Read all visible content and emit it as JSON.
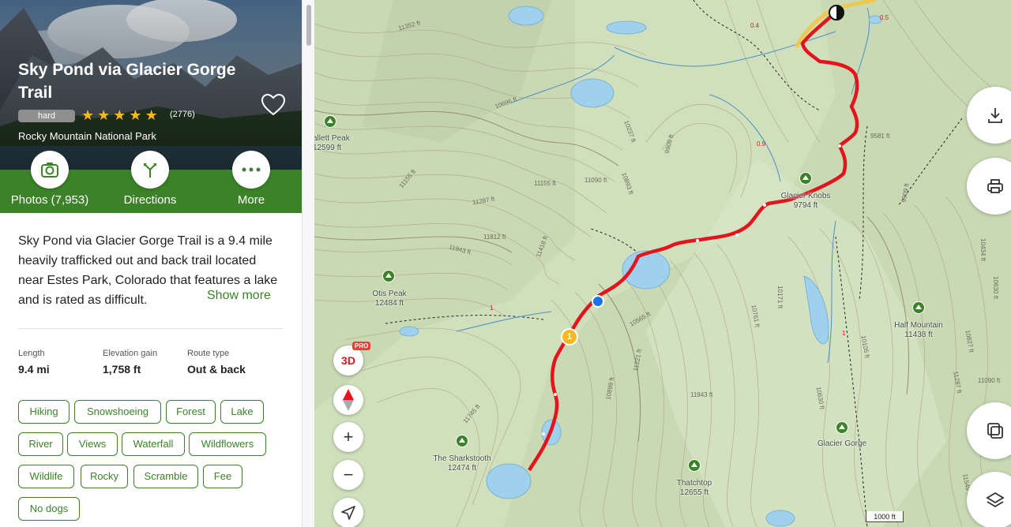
{
  "trail": {
    "title": "Sky Pond via Glacier Gorge Trail",
    "difficulty": "hard",
    "rating": 5,
    "review_count": "(2776)",
    "park": "Rocky Mountain National Park"
  },
  "actions": {
    "photos": "Photos (7,953)",
    "directions": "Directions",
    "more": "More"
  },
  "description": {
    "text": "Sky Pond via Glacier Gorge Trail is a 9.4 mile heavily trafficked out and back trail located near Estes Park, Colorado that features a lake and is rated as difficult.",
    "show_more": "Show more"
  },
  "stats": {
    "length_label": "Length",
    "length_value": "9.4 mi",
    "gain_label": "Elevation gain",
    "gain_value": "1,758 ft",
    "route_label": "Route type",
    "route_value": "Out & back"
  },
  "tags": [
    "Hiking",
    "Snowshoeing",
    "Forest",
    "Lake",
    "River",
    "Views",
    "Waterfall",
    "Wildflowers",
    "Wildlife",
    "Rocky",
    "Scramble",
    "Fee",
    "No dogs"
  ],
  "map": {
    "peaks": [
      {
        "name": "allett Peak",
        "elev": "12599 ft"
      },
      {
        "name": "Glacier Knobs",
        "elev": "9794 ft"
      },
      {
        "name": "Otis Peak",
        "elev": "12484 ft"
      },
      {
        "name": "Half Mountain",
        "elev": "11438 ft"
      },
      {
        "name": "The Sharkstooth",
        "elev": "12474 ft"
      },
      {
        "name": "Thatchtop",
        "elev": "12655 ft"
      },
      {
        "name": "Glacier Gorge",
        "elev": ""
      }
    ],
    "contour_labels": [
      "11352 ft",
      "10696 ft",
      "10237 ft",
      "9909 ft",
      "9581 ft",
      "11155 ft",
      "11155 ft",
      "11090 ft",
      "10893 ft",
      "11287 ft",
      "11812 ft",
      "11943 ft",
      "11418 ft",
      "10565 ft",
      "11221 ft",
      "10899 ft",
      "11943 ft",
      "11745 ft",
      "10171 ft",
      "10761 ft",
      "10105 ft",
      "9909 ft",
      "10434 ft",
      "10630 ft",
      "11287 ft",
      "11090 ft",
      "10827 ft",
      "10630 ft",
      "11549 ft"
    ],
    "distance_markers": [
      "0.5",
      "0.4",
      "0.9",
      "1",
      "1"
    ],
    "waypoint": "1",
    "controls": {
      "three_d": "3D",
      "pro": "PRO",
      "zoom_in": "+",
      "zoom_out": "−"
    },
    "scale": "1000 ft",
    "colors": {
      "trail": "#e3141b",
      "water": "#9fd0ec",
      "terrain": "#c8d9b3",
      "contour": "#a89e86",
      "brand": "#3b8228"
    }
  }
}
